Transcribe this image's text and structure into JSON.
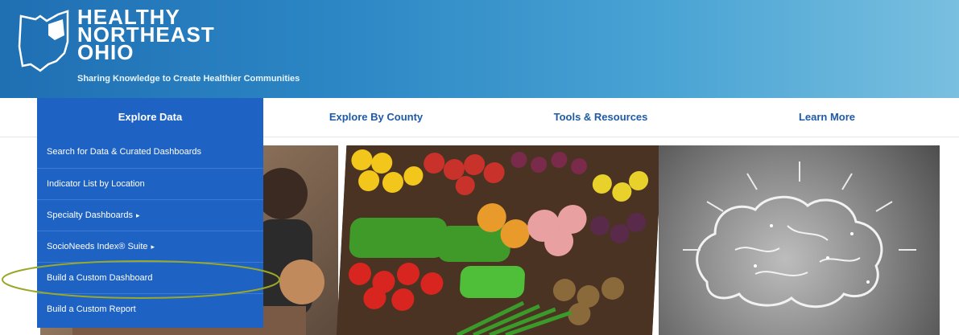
{
  "header": {
    "title_lines": [
      "HEALTHY",
      "NORTHEAST",
      "OHIO"
    ],
    "tagline": "Sharing Knowledge to Create Healthier Communities"
  },
  "nav": {
    "items": [
      {
        "label": "Explore Data"
      },
      {
        "label": "Explore By County"
      },
      {
        "label": "Tools & Resources"
      },
      {
        "label": "Learn More"
      }
    ]
  },
  "dropdown": {
    "items": [
      {
        "label": "Search for Data & Curated Dashboards",
        "arrow": ""
      },
      {
        "label": "Indicator List by Location",
        "arrow": ""
      },
      {
        "label": "Specialty Dashboards",
        "arrow": "▸"
      },
      {
        "label": "SocioNeeds Index® Suite",
        "arrow": "▸"
      },
      {
        "label": "Build a Custom Dashboard",
        "arrow": ""
      },
      {
        "label": "Build a Custom Report",
        "arrow": ""
      }
    ]
  },
  "colors": {
    "header_start": "#1f6fb3",
    "header_end": "#79bfe0",
    "menu_blue": "#1e62c4",
    "nav_text": "#1e5aa8",
    "highlight": "#9aa82a"
  }
}
